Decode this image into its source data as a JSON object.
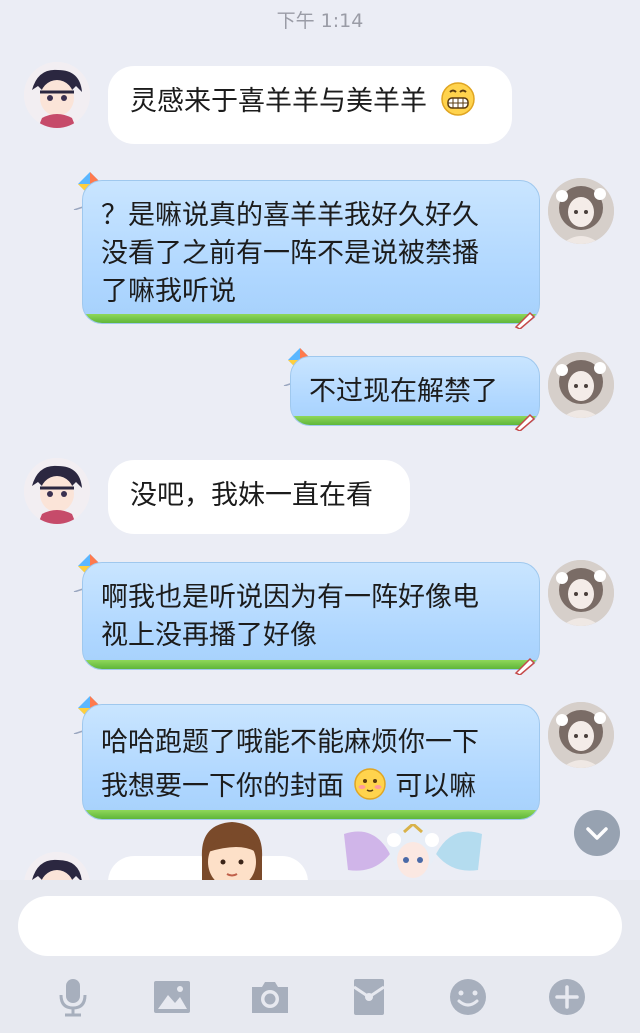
{
  "status": {
    "time": "下午 1:14"
  },
  "messages": [
    {
      "side": "left",
      "text": "灵感来于喜羊羊与美羊羊",
      "emoji": "grinning-emoji"
    },
    {
      "side": "right",
      "lines": [
        "？是嘛说真的喜羊羊我好久好久",
        "没看了之前有一阵不是说被禁播",
        "了嘛我听说"
      ]
    },
    {
      "side": "right",
      "lines": [
        "不过现在解禁了"
      ]
    },
    {
      "side": "left",
      "text": "没吧，我妹一直在看"
    },
    {
      "side": "right",
      "lines": [
        "啊我也是听说因为有一阵好像电",
        "视上没再播了好像"
      ]
    },
    {
      "side": "right",
      "lines": [
        "哈哈跑题了哦能不能麻烦你一下"
      ],
      "line2_before": "我想要一下你的封面",
      "line2_emoji": "blushing-emoji",
      "line2_after": "可以嘛"
    }
  ],
  "composer": {
    "placeholder": ""
  },
  "toolbar": {
    "items": [
      "microphone-icon",
      "image-icon",
      "camera-icon",
      "red-packet-icon",
      "emoji-icon",
      "plus-icon"
    ]
  }
}
